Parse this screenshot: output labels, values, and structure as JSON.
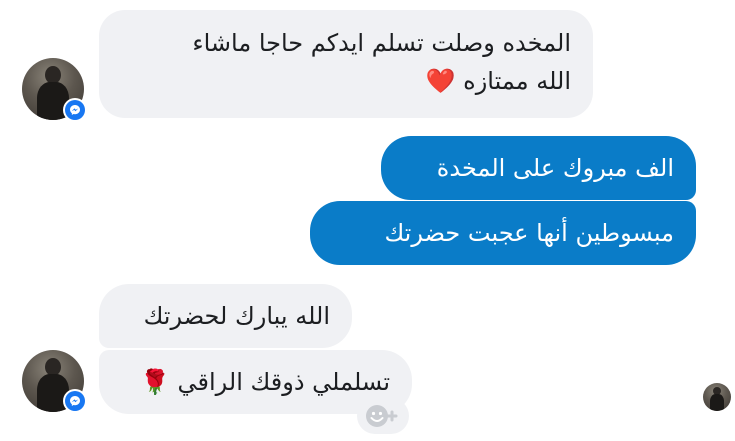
{
  "messages": [
    {
      "line1": "المخده وصلت تسلم ايدكم حاجا ماشاء",
      "line2": "الله ممتازه",
      "line2_emoji": "❤️"
    },
    {
      "text": "الف مبروك على المخدة"
    },
    {
      "text": "مبسوطين أنها عجبت حضرتك"
    },
    {
      "text": "الله يبارك لحضرتك"
    },
    {
      "text": "تسلملي ذوقك الراقي",
      "emoji": "🌹"
    }
  ],
  "icons": {
    "badge": "messenger-badge-icon",
    "react": "add-reaction-icon"
  },
  "colors": {
    "incoming_bubble": "#f0f1f4",
    "outgoing_bubble": "#0a7cc8",
    "messenger_blue": "#1877f2"
  }
}
